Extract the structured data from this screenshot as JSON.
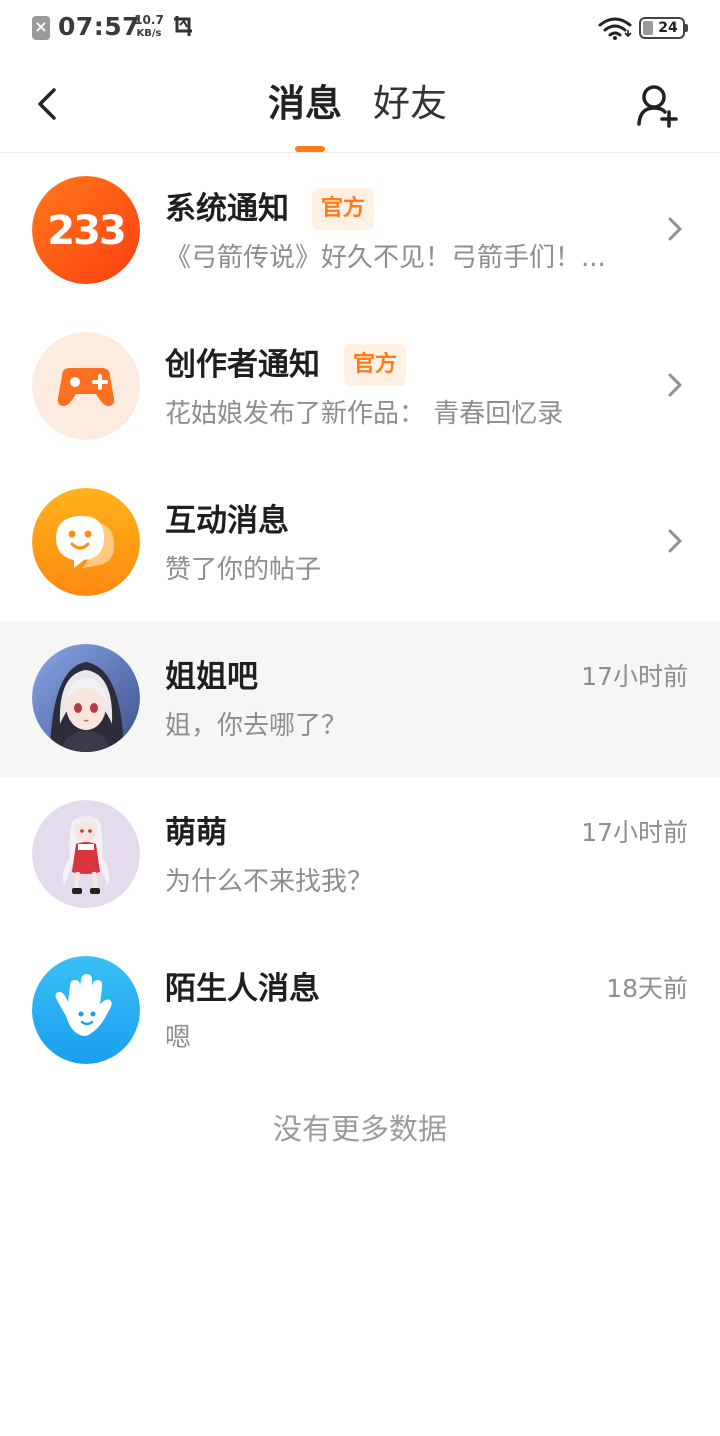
{
  "status_bar": {
    "time": "07:57",
    "net_speed_value": "10.7",
    "net_speed_unit": "KB/s",
    "battery": "24"
  },
  "header": {
    "tabs": [
      {
        "label": "消息",
        "active": true
      },
      {
        "label": "好友",
        "active": false
      }
    ],
    "accent_color": "#ff7a1a"
  },
  "messages": [
    {
      "title": "系统通知",
      "badge": "官方",
      "subtitle": "《弓箭传说》好久不见！弓箭手们！...",
      "icon": "233-logo-icon",
      "has_chevron": true
    },
    {
      "title": "创作者通知",
      "badge": "官方",
      "subtitle": "花姑娘发布了新作品：  青春回忆录",
      "icon": "gamepad-icon",
      "has_chevron": true
    },
    {
      "title": "互动消息",
      "subtitle": "赞了你的帖子",
      "icon": "chat-bubble-icon",
      "has_chevron": true
    },
    {
      "title": "姐姐吧",
      "subtitle": "姐，你去哪了？",
      "time": "17小时前",
      "icon": "user-avatar-anime-girl-silver-hair"
    },
    {
      "title": "萌萌",
      "subtitle": "为什么不来找我？",
      "time": "17小时前",
      "icon": "user-avatar-anime-girl-red-dress"
    },
    {
      "title": "陌生人消息",
      "subtitle": "嗯",
      "time": "18天前",
      "icon": "waving-hand-icon"
    }
  ],
  "footer": {
    "no_more_text": "没有更多数据"
  }
}
